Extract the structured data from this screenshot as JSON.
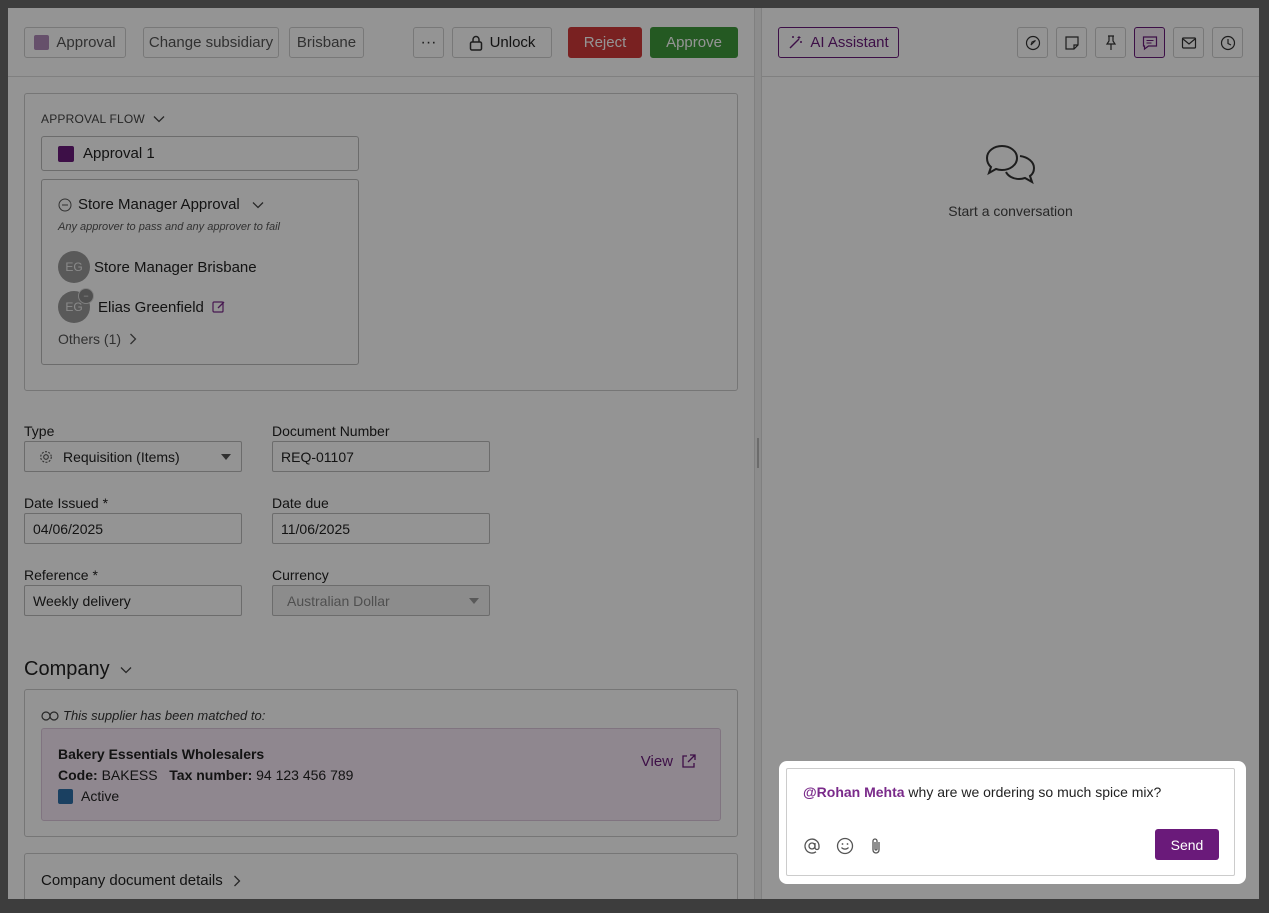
{
  "toolbar": {
    "approval_label": "Approval",
    "change_subsidiary_label": "Change subsidiary",
    "location_label": "Brisbane",
    "more_label": "···",
    "unlock_label": "Unlock",
    "reject_label": "Reject",
    "approve_label": "Approve",
    "colors": {
      "reject": "#d13a3a",
      "approve": "#3e9a3c",
      "brand": "#6a1a7a"
    }
  },
  "approval_flow": {
    "title": "APPROVAL FLOW",
    "stage_label": "Approval 1",
    "step": {
      "title": "Store Manager Approval",
      "subtitle": "Any approver to pass and any approver to fail",
      "approvers": [
        {
          "initials": "EG",
          "name": "Store Manager Brisbane"
        },
        {
          "initials": "EG",
          "name": "Elias Greenfield"
        }
      ],
      "others_label": "Others (1)"
    }
  },
  "form": {
    "type_label": "Type",
    "type_value": "Requisition (Items)",
    "doc_number_label": "Document Number",
    "doc_number_value": "REQ-01107",
    "date_issued_label": "Date Issued *",
    "date_issued_value": "04/06/2025",
    "date_due_label": "Date due",
    "date_due_value": "11/06/2025",
    "reference_label": "Reference *",
    "reference_value": "Weekly delivery",
    "currency_label": "Currency",
    "currency_value": "Australian Dollar"
  },
  "company": {
    "heading": "Company",
    "matched_text": "This supplier has been matched to:",
    "supplier_name": "Bakery Essentials Wholesalers",
    "code_label": "Code:",
    "code_value": "BAKESS",
    "tax_label": "Tax number:",
    "tax_value": "94 123 456 789",
    "status": "Active",
    "view_label": "View"
  },
  "company_doc_details": {
    "title": "Company document details"
  },
  "right_panel": {
    "ai_assistant_label": "AI Assistant",
    "icons": [
      "compass-icon",
      "note-icon",
      "pin-icon",
      "chat-icon",
      "mail-icon",
      "history-icon"
    ],
    "empty_state": "Start a conversation"
  },
  "composer": {
    "mention": "@Rohan Mehta",
    "message": " why are we ordering so much spice mix?",
    "send_label": "Send"
  }
}
